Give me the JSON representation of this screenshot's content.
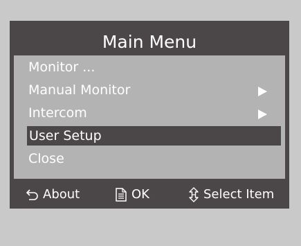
{
  "menu": {
    "title": "Main Menu",
    "items": [
      {
        "label": "Monitor ...",
        "has_submenu": false,
        "selected": false
      },
      {
        "label": "Manual Monitor",
        "has_submenu": true,
        "selected": false
      },
      {
        "label": "Intercom",
        "has_submenu": true,
        "selected": false
      },
      {
        "label": "User Setup",
        "has_submenu": false,
        "selected": true
      },
      {
        "label": "Close",
        "has_submenu": false,
        "selected": false
      }
    ]
  },
  "footer": {
    "about": {
      "label": "About",
      "icon": "back-arrow-icon"
    },
    "ok": {
      "label": "OK",
      "icon": "document-icon"
    },
    "select": {
      "label": "Select Item",
      "icon": "up-down-arrow-icon"
    }
  },
  "colors": {
    "background": "#c9c9c9",
    "frame": "#4b4647",
    "panel": "#b3b3b3",
    "text": "#ffffff"
  }
}
